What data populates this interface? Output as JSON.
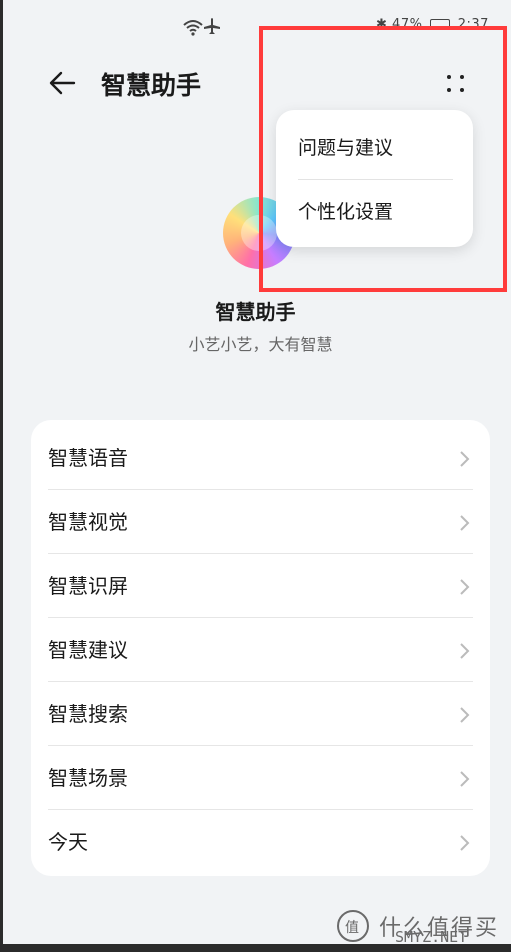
{
  "status_bar": {
    "battery_text": "47%",
    "time": "2:37"
  },
  "header": {
    "title": "智慧助手"
  },
  "popup_menu": {
    "items": [
      {
        "label": "问题与建议"
      },
      {
        "label": "个性化设置"
      }
    ]
  },
  "app": {
    "name": "智慧助手",
    "tagline": "小艺小艺，大有智慧"
  },
  "settings_list": {
    "items": [
      {
        "label": "智慧语音"
      },
      {
        "label": "智慧视觉"
      },
      {
        "label": "智慧识屏"
      },
      {
        "label": "智慧建议"
      },
      {
        "label": "智慧搜索"
      },
      {
        "label": "智慧场景"
      },
      {
        "label": "今天"
      }
    ]
  },
  "watermark": {
    "line1": "什么值得买",
    "line2": "SMYZ.NET"
  },
  "colors": {
    "background": "#f1f3f5",
    "card": "#ffffff",
    "highlight": "#ff3b3b"
  }
}
